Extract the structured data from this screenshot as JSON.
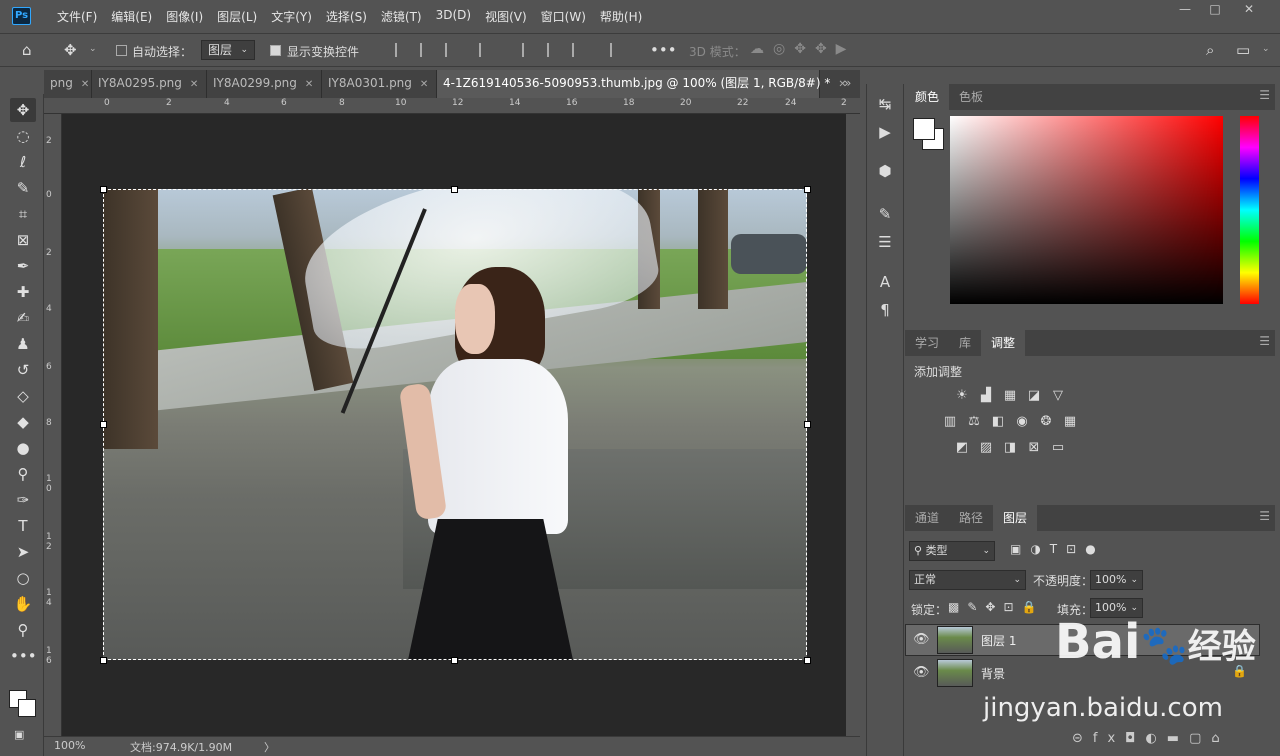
{
  "app": {
    "logo": "Ps"
  },
  "menubar": {
    "items": [
      "文件(F)",
      "编辑(E)",
      "图像(I)",
      "图层(L)",
      "文字(Y)",
      "选择(S)",
      "滤镜(T)",
      "3D(D)",
      "视图(V)",
      "窗口(W)",
      "帮助(H)"
    ]
  },
  "window_controls": {
    "minimize": "—",
    "maximize": "□",
    "close": "✕"
  },
  "options": {
    "auto_select_label": "自动选择：",
    "auto_select_target": "图层",
    "show_transform_label": "显示变换控件",
    "mode_3d_label": "3D 模式："
  },
  "tabs": [
    {
      "label": "png",
      "close": "✕"
    },
    {
      "label": "IY8A0295.png",
      "close": "✕"
    },
    {
      "label": "IY8A0299.png",
      "close": "✕"
    },
    {
      "label": "IY8A0301.png",
      "close": "✕"
    },
    {
      "label": "4-1Z619140536-5090953.thumb.jpg @ 100% (图层 1, RGB/8#) *",
      "close": "✕"
    }
  ],
  "tabs_overflow": "»",
  "ruler_h": [
    "0",
    "2",
    "4",
    "6",
    "8",
    "10",
    "12",
    "14",
    "16",
    "18",
    "20",
    "22",
    "24",
    "2"
  ],
  "ruler_v": [
    "2",
    "0",
    "2",
    "4",
    "6",
    "8",
    "1 0",
    "1 2",
    "1 4",
    "1 6"
  ],
  "status": {
    "zoom": "100%",
    "doc": "文档:974.9K/1.90M",
    "arrow": "〉"
  },
  "color_panel": {
    "tabs": [
      "颜色",
      "色板"
    ]
  },
  "adjust_panel": {
    "tabs": [
      "学习",
      "库",
      "调整"
    ],
    "heading": "添加调整"
  },
  "layers_panel": {
    "tabs": [
      "通道",
      "路径",
      "图层"
    ],
    "filter_kind": "类型",
    "blend_mode": "正常",
    "opacity_label": "不透明度：",
    "opacity_value": "100%",
    "lock_label": "锁定：",
    "fill_label": "填充：",
    "fill_value": "100%",
    "layers": [
      {
        "name": "图层 1"
      },
      {
        "name": "背景"
      }
    ]
  },
  "watermark": {
    "brand_text": "Bai",
    "brand_text2": "经验",
    "url": "jingyan.baidu.com"
  }
}
